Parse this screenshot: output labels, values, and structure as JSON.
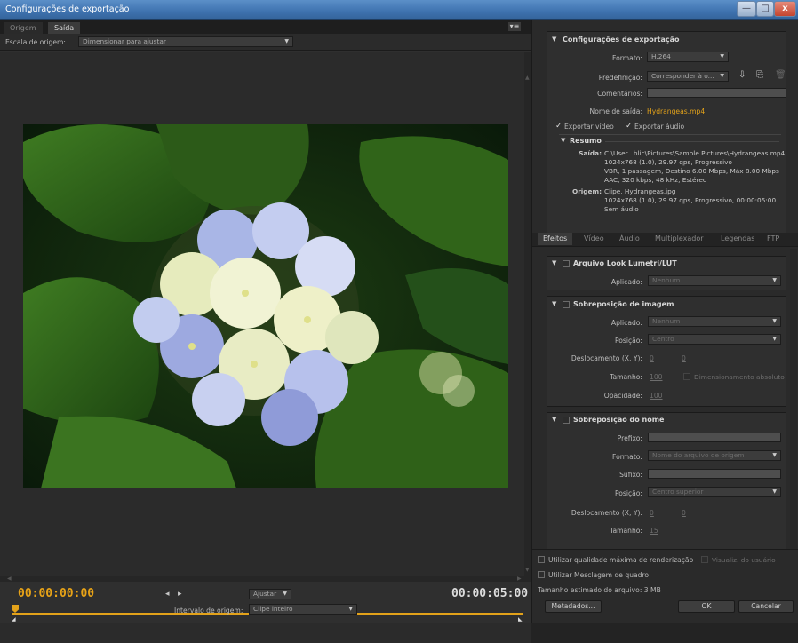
{
  "window": {
    "title": "Configurações de exportação",
    "minimize": "—",
    "maximize": "□",
    "close": "x"
  },
  "source_tabs": [
    {
      "label": "Origem"
    },
    {
      "label": "Saída"
    }
  ],
  "scale": {
    "label": "Escala de origem:",
    "value": "Dimensionar para ajustar"
  },
  "preview": {
    "image_subject": "Hydrangeas"
  },
  "timeline": {
    "current_tc": "00:00:00:00",
    "end_tc": "00:00:05:00",
    "fit_value": "Ajustar",
    "mark_in_icon": "mark-in-icon",
    "mark_out_icon": "mark-out-icon"
  },
  "range": {
    "label": "Intervalo de origem:",
    "value": "Clipe inteiro"
  },
  "export": {
    "heading": "Configurações de exportação",
    "format_label": "Formato:",
    "format_value": "H.264",
    "preset_label": "Predefinição:",
    "preset_value": "Corresponder à o...",
    "comments_label": "Comentários:",
    "output_label": "Nome de saída:",
    "output_value": "Hydrangeas.mp4",
    "export_video": "Exportar vídeo",
    "export_audio": "Exportar áudio"
  },
  "summary": {
    "heading": "Resumo",
    "output_label": "Saída:",
    "output_lines": [
      "C:\\User...blic\\Pictures\\Sample Pictures\\Hydrangeas.mp4",
      "1024x768 (1.0), 29.97 qps, Progressivo",
      "VBR, 1 passagem, Destino 6.00 Mbps, Máx 8.00 Mbps",
      "AAC, 320 kbps, 48 kHz, Estéreo"
    ],
    "source_label": "Origem:",
    "source_lines": [
      "Clipe, Hydrangeas.jpg",
      "1024x768 (1.0), 29.97 qps, Progressivo, 00:00:05:00",
      "Sem áudio"
    ]
  },
  "effect_tabs": [
    {
      "label": "Efeitos"
    },
    {
      "label": "Vídeo"
    },
    {
      "label": "Áudio"
    },
    {
      "label": "Multiplexador"
    },
    {
      "label": "Legendas"
    },
    {
      "label": "FTP"
    }
  ],
  "lumetri": {
    "heading": "Arquivo Look Lumetri/LUT",
    "applied_label": "Aplicado:",
    "applied_value": "Nenhum"
  },
  "image_overlay": {
    "heading": "Sobreposição de imagem",
    "applied_label": "Aplicado:",
    "applied_value": "Nenhum",
    "position_label": "Posição:",
    "position_value": "Centro",
    "offset_label": "Deslocamento (X, Y):",
    "offset_x": "0",
    "offset_y": "0",
    "size_label": "Tamanho:",
    "size_value": "100",
    "absolute_label": "Dimensionamento absoluto",
    "opacity_label": "Opacidade:",
    "opacity_value": "100"
  },
  "name_overlay": {
    "heading": "Sobreposição do nome",
    "prefix_label": "Prefixo:",
    "format_label": "Formato:",
    "format_value": "Nome do arquivo de origem",
    "suffix_label": "Sufixo:",
    "position_label": "Posição:",
    "position_value": "Centro superior",
    "offset_label": "Deslocamento (X, Y):",
    "offset_x": "0",
    "offset_y": "0",
    "size_label": "Tamanho:",
    "size_value": "15"
  },
  "bottom": {
    "max_quality": "Utilizar qualidade máxima de renderização",
    "user_preview": "Visualiz. do usuário",
    "frame_blend": "Utilizar Mesclagem de quadro",
    "estimated_size": "Tamanho estimado do arquivo:  3 MB",
    "metadata_btn": "Metadados...",
    "ok_btn": "OK",
    "cancel_btn": "Cancelar"
  },
  "colors": {
    "accent": "#e3a21a",
    "link": "#e3a21a",
    "title_bar": "#3f73b0"
  }
}
